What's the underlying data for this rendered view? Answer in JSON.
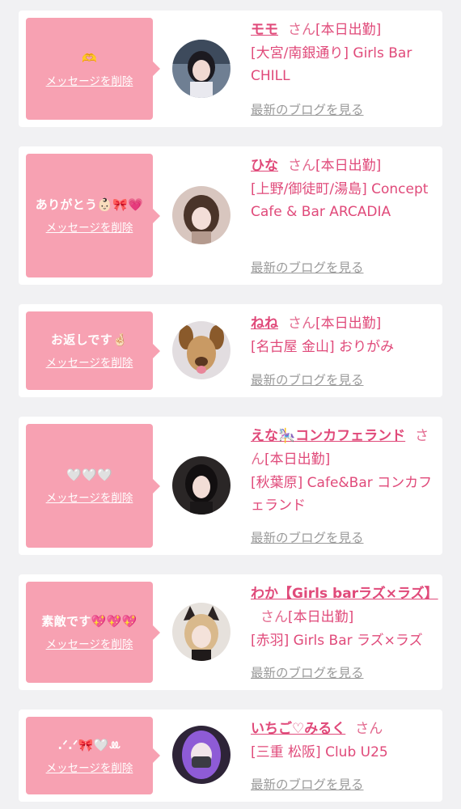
{
  "common": {
    "delete_label": "メッセージを削除",
    "blog_label": "最新のブログを見る",
    "san_label": "さん",
    "at_work_label": "[本日出勤]"
  },
  "colors": {
    "page_bg": "#f1f1f3",
    "bubble": "#f7a1b2",
    "accent_text": "#e04a7a",
    "link_gray": "#9a9a9a"
  },
  "messages": [
    {
      "text": "🫶",
      "name": "モモ",
      "shop": "[大宮/南銀通り] Girls Bar CHILL",
      "at_work": true,
      "avatar_icon": "girl-avatar-icon"
    },
    {
      "text": "ありがとう👶🏻🎀💗",
      "name": "ひな",
      "shop": "[上野/御徒町/湯島] Concept Cafe & Bar ARCADIA",
      "at_work": true,
      "avatar_icon": "girl-avatar-icon"
    },
    {
      "text": "お返しです🤞🏻",
      "name": "ねね",
      "shop": "[名古屋 金山] おりがみ",
      "at_work": true,
      "avatar_icon": "dog-filter-avatar-icon"
    },
    {
      "text": "🤍🤍🤍",
      "name": "えな🎠コンカフェランド",
      "shop": "[秋葉原] Cafe&Bar コンカフェランド",
      "at_work": true,
      "avatar_icon": "girl-avatar-icon"
    },
    {
      "text": "素敵です💖💖💖",
      "name": "わか【Girls barラズ×ラズ】",
      "shop": "[赤羽] Girls Bar ラズ×ラズ",
      "at_work": true,
      "avatar_icon": "cat-ears-avatar-icon"
    },
    {
      "text": ".ᐟ.ᐟ🎀🤍ꔛ",
      "name": "いちご♡みるく",
      "shop": "[三重 松阪] Club U25",
      "at_work": false,
      "avatar_icon": "purple-hair-avatar-icon"
    }
  ]
}
